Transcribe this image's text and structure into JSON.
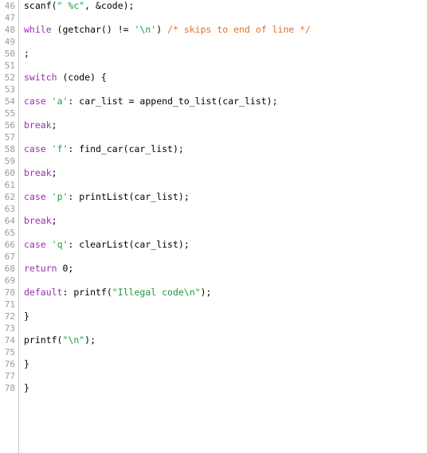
{
  "editor": {
    "language": "C",
    "first_line_number": 46,
    "last_line_number": 78,
    "colors": {
      "background": "#ffffff",
      "text": "#000000",
      "line_number": "#9a9a9a",
      "gutter_rule": "#c8c8c8",
      "keyword": "#9b30b0",
      "string": "#1a9e34",
      "comment": "#e0702a"
    }
  },
  "lines": [
    {
      "number": "46",
      "tokens": [
        {
          "t": "scanf(",
          "c": "plain"
        },
        {
          "t": "\" %c\"",
          "c": "string"
        },
        {
          "t": ", &code);",
          "c": "plain"
        }
      ]
    },
    {
      "number": "47",
      "tokens": []
    },
    {
      "number": "48",
      "tokens": [
        {
          "t": "while",
          "c": "keyword"
        },
        {
          "t": " (getchar() != ",
          "c": "plain"
        },
        {
          "t": "'\\n'",
          "c": "string"
        },
        {
          "t": ") ",
          "c": "plain"
        },
        {
          "t": "/* skips to end of line */",
          "c": "comment"
        }
      ]
    },
    {
      "number": "49",
      "tokens": []
    },
    {
      "number": "50",
      "tokens": [
        {
          "t": ";",
          "c": "plain"
        }
      ]
    },
    {
      "number": "51",
      "tokens": []
    },
    {
      "number": "52",
      "tokens": [
        {
          "t": "switch",
          "c": "keyword"
        },
        {
          "t": " (code) {",
          "c": "plain"
        }
      ]
    },
    {
      "number": "53",
      "tokens": []
    },
    {
      "number": "54",
      "tokens": [
        {
          "t": "case",
          "c": "keyword"
        },
        {
          "t": " ",
          "c": "plain"
        },
        {
          "t": "'a'",
          "c": "string"
        },
        {
          "t": ": car_list = append_to_list(car_list);",
          "c": "plain"
        }
      ]
    },
    {
      "number": "55",
      "tokens": []
    },
    {
      "number": "56",
      "tokens": [
        {
          "t": "break",
          "c": "keyword"
        },
        {
          "t": ";",
          "c": "plain"
        }
      ]
    },
    {
      "number": "57",
      "tokens": []
    },
    {
      "number": "58",
      "tokens": [
        {
          "t": "case",
          "c": "keyword"
        },
        {
          "t": " ",
          "c": "plain"
        },
        {
          "t": "'f'",
          "c": "string"
        },
        {
          "t": ": find_car(car_list);",
          "c": "plain"
        }
      ]
    },
    {
      "number": "59",
      "tokens": []
    },
    {
      "number": "60",
      "tokens": [
        {
          "t": "break",
          "c": "keyword"
        },
        {
          "t": ";",
          "c": "plain"
        }
      ]
    },
    {
      "number": "61",
      "tokens": []
    },
    {
      "number": "62",
      "tokens": [
        {
          "t": "case",
          "c": "keyword"
        },
        {
          "t": " ",
          "c": "plain"
        },
        {
          "t": "'p'",
          "c": "string"
        },
        {
          "t": ": printList(car_list);",
          "c": "plain"
        }
      ]
    },
    {
      "number": "63",
      "tokens": []
    },
    {
      "number": "64",
      "tokens": [
        {
          "t": "break",
          "c": "keyword"
        },
        {
          "t": ";",
          "c": "plain"
        }
      ]
    },
    {
      "number": "65",
      "tokens": []
    },
    {
      "number": "66",
      "tokens": [
        {
          "t": "case",
          "c": "keyword"
        },
        {
          "t": " ",
          "c": "plain"
        },
        {
          "t": "'q'",
          "c": "string"
        },
        {
          "t": ": clearList(car_list);",
          "c": "plain"
        }
      ]
    },
    {
      "number": "67",
      "tokens": []
    },
    {
      "number": "68",
      "tokens": [
        {
          "t": "return",
          "c": "keyword"
        },
        {
          "t": " 0;",
          "c": "plain"
        }
      ]
    },
    {
      "number": "69",
      "tokens": []
    },
    {
      "number": "70",
      "tokens": [
        {
          "t": "default",
          "c": "keyword"
        },
        {
          "t": ": printf(",
          "c": "plain"
        },
        {
          "t": "\"Illegal code\\n\"",
          "c": "string"
        },
        {
          "t": ");",
          "c": "plain"
        }
      ]
    },
    {
      "number": "71",
      "tokens": []
    },
    {
      "number": "72",
      "tokens": [
        {
          "t": "}",
          "c": "plain"
        }
      ]
    },
    {
      "number": "73",
      "tokens": []
    },
    {
      "number": "74",
      "tokens": [
        {
          "t": "printf(",
          "c": "plain"
        },
        {
          "t": "\"\\n\"",
          "c": "string"
        },
        {
          "t": ");",
          "c": "plain"
        }
      ]
    },
    {
      "number": "75",
      "tokens": []
    },
    {
      "number": "76",
      "tokens": [
        {
          "t": "}",
          "c": "plain"
        }
      ]
    },
    {
      "number": "77",
      "tokens": []
    },
    {
      "number": "78",
      "tokens": [
        {
          "t": "}",
          "c": "plain"
        }
      ]
    }
  ]
}
